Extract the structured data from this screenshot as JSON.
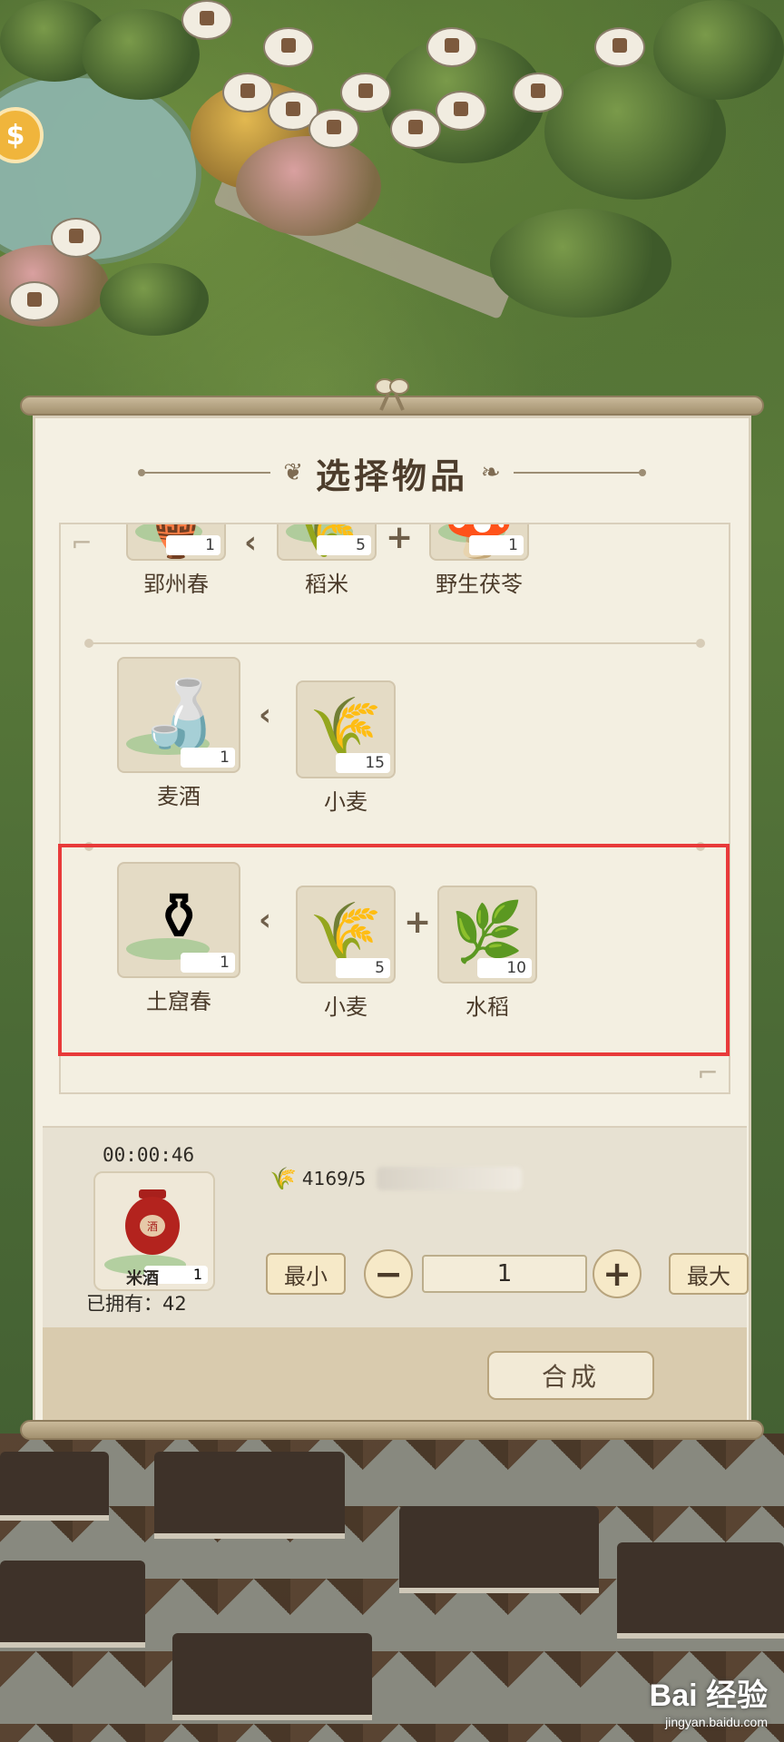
{
  "dialog": {
    "title": "选择物品",
    "recipes": [
      {
        "product": {
          "name": "郢州春",
          "count": "1"
        },
        "ingredients": [
          {
            "name": "稻米",
            "count": "5"
          },
          {
            "name": "野生茯苓",
            "count": "1"
          }
        ]
      },
      {
        "product": {
          "name": "麦酒",
          "count": "1"
        },
        "ingredients": [
          {
            "name": "小麦",
            "count": "15"
          }
        ]
      },
      {
        "product": {
          "name": "土窟春",
          "count": "1"
        },
        "ingredients": [
          {
            "name": "小麦",
            "count": "5"
          },
          {
            "name": "水稻",
            "count": "10"
          }
        ]
      }
    ]
  },
  "craft": {
    "timer": "00:00:46",
    "item": {
      "name": "米酒",
      "count": "1"
    },
    "owned_label": "已拥有：42",
    "resource": {
      "value": "4169/5",
      "icon": "wheat-icon"
    },
    "min_label": "最小",
    "max_label": "最大",
    "quantity": "1",
    "synth_label": "合成"
  },
  "watermark": {
    "text": "Bai 经验",
    "sub": "jingyan.baidu.com"
  },
  "colors": {
    "highlight": "#e83a3a",
    "panel": "#f4f0e3",
    "button": "#f6e9c8"
  }
}
